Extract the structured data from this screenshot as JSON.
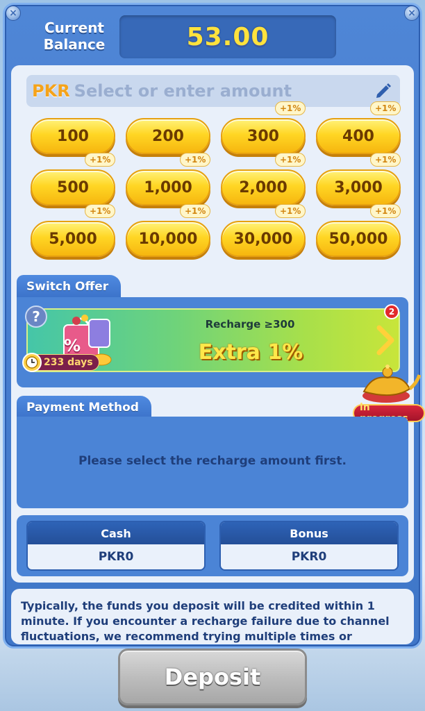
{
  "header": {
    "balance_label": "Current Balance",
    "balance_value": "53.00"
  },
  "amount_input": {
    "currency": "PKR",
    "placeholder": "Select or enter amount"
  },
  "amounts": [
    {
      "label": "100",
      "bonus": ""
    },
    {
      "label": "200",
      "bonus": ""
    },
    {
      "label": "300",
      "bonus": "+1%"
    },
    {
      "label": "400",
      "bonus": "+1%"
    },
    {
      "label": "500",
      "bonus": "+1%"
    },
    {
      "label": "1,000",
      "bonus": "+1%"
    },
    {
      "label": "2,000",
      "bonus": "+1%"
    },
    {
      "label": "3,000",
      "bonus": "+1%"
    },
    {
      "label": "5,000",
      "bonus": "+1%"
    },
    {
      "label": "10,000",
      "bonus": "+1%"
    },
    {
      "label": "30,000",
      "bonus": "+1%"
    },
    {
      "label": "50,000",
      "bonus": "+1%"
    }
  ],
  "offer": {
    "tab_label": "Switch Offer",
    "help": "?",
    "badge_count": "2",
    "percent_icon": "%",
    "days": "233 days",
    "title": "Recharge ≥300",
    "extra": "Extra  1%"
  },
  "lamp": {
    "label": "in progress"
  },
  "payment": {
    "tab_label": "Payment Method",
    "message": "Please select the recharge amount first."
  },
  "wallet": {
    "cash_label": "Cash",
    "cash_value": "PKR0",
    "bonus_label": "Bonus",
    "bonus_value": "PKR0"
  },
  "notice": {
    "text": "Typically, the funds you deposit will be credited within 1 minute. If you encounter a recharge failure due to channel fluctuations, we recommend trying multiple times or contacting our customer"
  },
  "deposit": {
    "label": "Deposit"
  },
  "colors": {
    "accent_gold": "#ffd624",
    "panel_blue": "#4b84d6",
    "balance_yellow": "#ffe23d"
  }
}
